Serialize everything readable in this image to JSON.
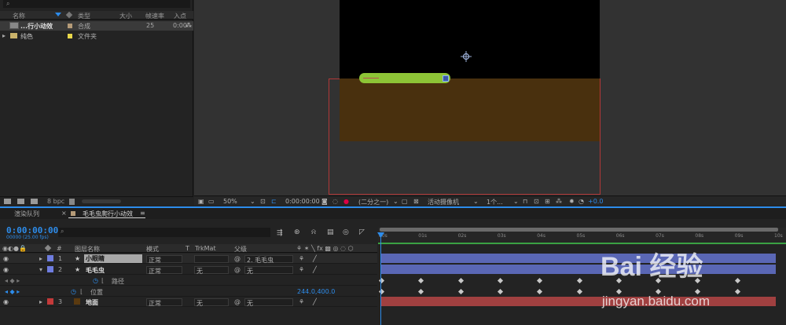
{
  "project": {
    "headers": {
      "name": "名称",
      "type": "类型",
      "size": "大小",
      "fps": "帧速率",
      "in": "入点"
    },
    "items": [
      {
        "name": "...行小动效",
        "type": "合成",
        "fps": "25",
        "in": "0:00"
      },
      {
        "name": "纯色",
        "type": "文件夹",
        "fps": "",
        "in": ""
      }
    ],
    "footer_bpc": "8 bpc"
  },
  "viewer": {
    "zoom": "50%",
    "time": "0:00:00:00",
    "resolution": "(二分之一)",
    "camera": "活动摄像机",
    "views": "1个...",
    "exposure": "+0.0"
  },
  "timeline": {
    "tab_render": "渲染队列",
    "tab_close": "×",
    "tab_comp": "毛毛虫爬行小动效",
    "tab_menu": "≡",
    "timecode": "0:00:00:00",
    "fps_label": "00000 (25.00 fps)",
    "headers": {
      "num": "#",
      "layer_name": "图层名称",
      "mode": "模式",
      "t": "T",
      "trkmat": "TrkMat",
      "parent": "父级"
    },
    "ticks": [
      "00s",
      "01s",
      "02s",
      "03s",
      "04s",
      "05s",
      "06s",
      "07s",
      "08s",
      "09s",
      "10s"
    ],
    "layers": [
      {
        "num": "1",
        "name": "小眼睛",
        "mode": "正常",
        "trkmat": "",
        "parent": "2. 毛毛虫",
        "color": "#6f7de0"
      },
      {
        "num": "2",
        "name": "毛毛虫",
        "mode": "正常",
        "trkmat": "无",
        "parent": "无",
        "color": "#6f7de0"
      },
      {
        "num": "",
        "name": "路径",
        "sub": true
      },
      {
        "num": "",
        "name": "位置",
        "sub": true,
        "value": "244.0,400.0"
      },
      {
        "num": "3",
        "name": "地面",
        "mode": "正常",
        "trkmat": "无",
        "parent": "无",
        "color": "#c43a3a"
      }
    ]
  },
  "watermark": {
    "brand": "Bai 经验",
    "url": "jingyan.baidu.com"
  },
  "colors": {
    "accent": "#2d8ceb",
    "worm": "#8dc436",
    "ground": "#49300e",
    "layer_blue": "#5a67b5",
    "layer_red": "#a04040"
  }
}
